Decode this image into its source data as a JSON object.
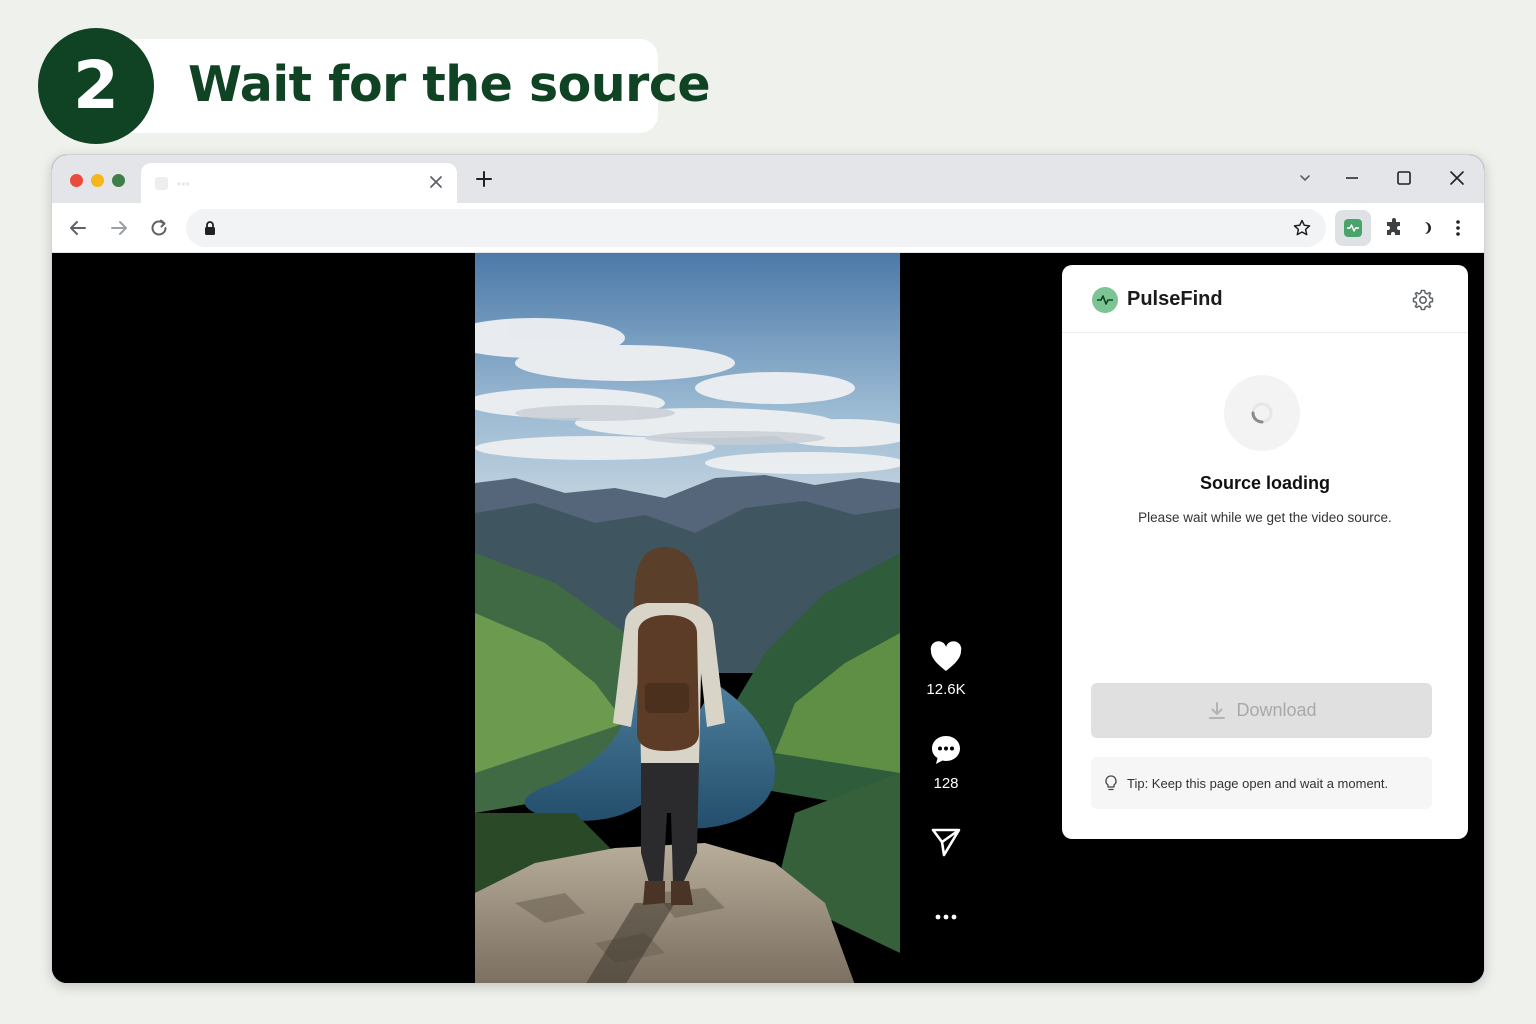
{
  "step": {
    "number": "2",
    "title": "Wait for the source"
  },
  "browser": {
    "tab": {
      "title": "•••"
    },
    "address": {
      "url": ""
    }
  },
  "video": {
    "actions": [
      {
        "icon": "heart-icon",
        "count": "12.6K"
      },
      {
        "icon": "comment-icon",
        "count": "128"
      },
      {
        "icon": "share-icon",
        "count": ""
      },
      {
        "icon": "more-icon",
        "count": ""
      }
    ]
  },
  "popup": {
    "brand": "PulseFind",
    "status_title": "Source loading",
    "status_desc": "Please wait while we get the video source.",
    "download_label": "Download",
    "tip": "Tip: Keep this page open and wait a moment."
  },
  "colors": {
    "brand_dark_green": "#0f4323",
    "extension_green": "#4aa36b",
    "page_background": "#eff1ec"
  }
}
